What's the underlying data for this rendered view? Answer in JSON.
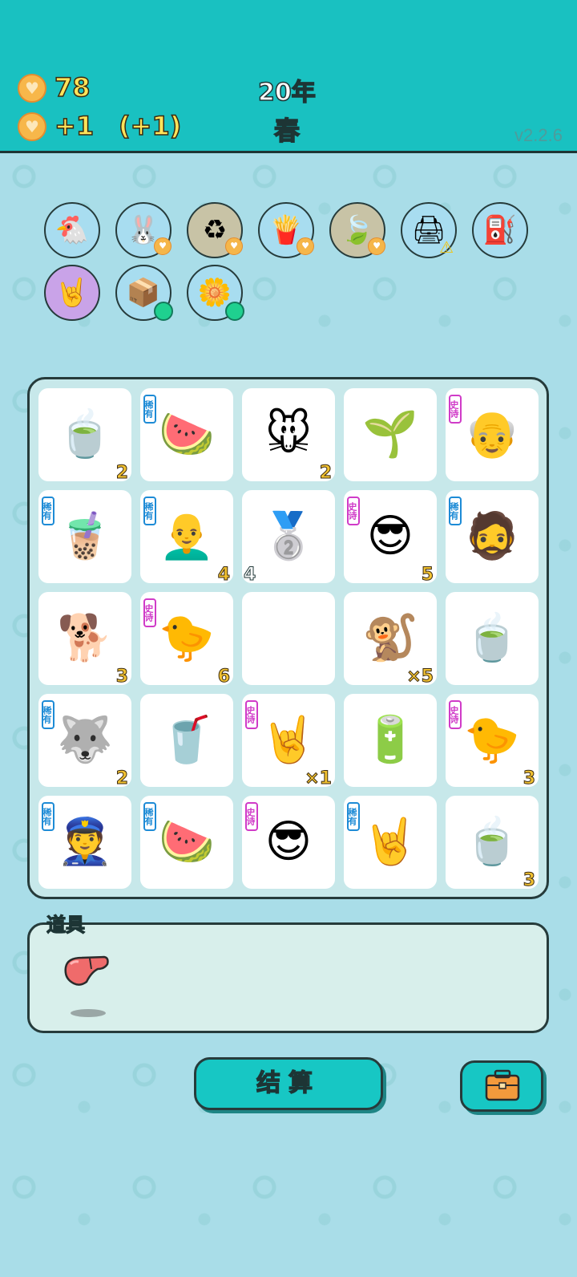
{
  "header": {
    "coins": "78",
    "income": "+1",
    "income_bonus": "(+1)",
    "year": "20年",
    "season": "春",
    "version": "v2.2.6"
  },
  "relics": [
    {
      "name": "chicken-egg-icon",
      "glyph": "🐔"
    },
    {
      "name": "rabbit-icon",
      "glyph": "🐰"
    },
    {
      "name": "recycle-icon",
      "glyph": "♻"
    },
    {
      "name": "fries-icon",
      "glyph": "🍟"
    },
    {
      "name": "leaf-icon",
      "glyph": "🍃"
    },
    {
      "name": "printer-icon",
      "glyph": "🖨"
    },
    {
      "name": "pump-icon",
      "glyph": "⛽"
    },
    {
      "name": "rock-hand-icon",
      "glyph": "🤘"
    },
    {
      "name": "parcel-box-icon",
      "glyph": "📦"
    },
    {
      "name": "potted-flower-icon",
      "glyph": "🌼"
    }
  ],
  "board": {
    "cells": [
      {
        "name": "soup-bowl",
        "glyph": "🍵",
        "tag": "",
        "count": "2"
      },
      {
        "name": "watermelon",
        "glyph": "🍉",
        "tag": "稀有",
        "count": ""
      },
      {
        "name": "mouse",
        "glyph": "🐭",
        "tag": "",
        "count": "2"
      },
      {
        "name": "sprout",
        "glyph": "🌱",
        "tag": "",
        "count": ""
      },
      {
        "name": "bald-old-man",
        "glyph": "👴",
        "tag": "史诗",
        "count": ""
      },
      {
        "name": "bubble-tea",
        "glyph": "🧋",
        "tag": "稀有",
        "count": ""
      },
      {
        "name": "bald-man",
        "glyph": "👨‍🦲",
        "tag": "稀有",
        "count": "4"
      },
      {
        "name": "silver-bars",
        "glyph": "🥈",
        "tag": "",
        "count": "",
        "count_left": "4"
      },
      {
        "name": "green-cap-man",
        "glyph": "😎",
        "tag": "史诗",
        "count": "5"
      },
      {
        "name": "hat-man",
        "glyph": "🧔",
        "tag": "稀有",
        "count": ""
      },
      {
        "name": "dog",
        "glyph": "🐕",
        "tag": "",
        "count": "3"
      },
      {
        "name": "yellow-chick",
        "glyph": "🐤",
        "tag": "史诗",
        "count": "6"
      },
      {
        "name": "empty",
        "glyph": "",
        "tag": "",
        "count": ""
      },
      {
        "name": "monkey",
        "glyph": "🐒",
        "tag": "",
        "count": "×5"
      },
      {
        "name": "tea-bag",
        "glyph": "🍵",
        "tag": "",
        "count": ""
      },
      {
        "name": "husky",
        "glyph": "🐺",
        "tag": "稀有",
        "count": "2"
      },
      {
        "name": "cola-cup",
        "glyph": "🥤",
        "tag": "",
        "count": ""
      },
      {
        "name": "rock-hand-grey",
        "glyph": "🤘",
        "tag": "史诗",
        "count": "×1"
      },
      {
        "name": "power-bank",
        "glyph": "🔋",
        "tag": "",
        "count": ""
      },
      {
        "name": "yellow-chick-2",
        "glyph": "🐤",
        "tag": "史诗",
        "count": "3"
      },
      {
        "name": "police-officer",
        "glyph": "👮",
        "tag": "稀有",
        "count": ""
      },
      {
        "name": "watermelon-2",
        "glyph": "🍉",
        "tag": "稀有",
        "count": ""
      },
      {
        "name": "green-cap-man-2",
        "glyph": "😎",
        "tag": "史诗",
        "count": ""
      },
      {
        "name": "rock-hand-brown",
        "glyph": "🤘",
        "tag": "稀有",
        "count": ""
      },
      {
        "name": "soup-bowl-2",
        "glyph": "🍵",
        "tag": "",
        "count": "3"
      }
    ]
  },
  "items": {
    "label": "道具",
    "list": [
      {
        "name": "liver-icon"
      }
    ]
  },
  "settle_button": "结算",
  "bag_button": {
    "icon": "briefcase-icon"
  }
}
